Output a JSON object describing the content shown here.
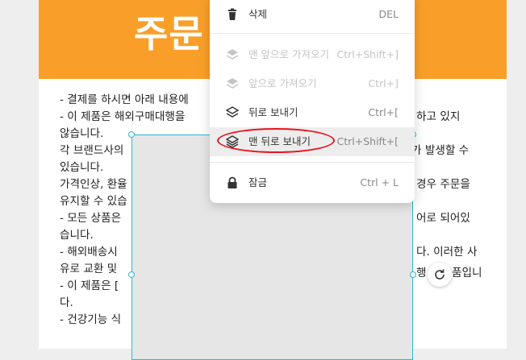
{
  "page": {
    "title": "주문",
    "lines": [
      "- 결제를 하시면 아래 내용에",
      "- 이 제품은 해외구매대행을",
      "않습니다.",
      "각 브랜드사의",
      "있습니다.",
      "가격인상, 환율",
      "유지할 수 있습",
      "- 모든 상품은",
      "습니다.",
      "- 해외배송시",
      "유로 교환 및",
      "- 이 제품은 [",
      "다.",
      "- 건강기능 식"
    ],
    "right_fragments": [
      "하고 있지",
      "가 발생할 수",
      "경우 주문을",
      "어로 되어있",
      "다. 이러한 사",
      "행",
      "품입니"
    ]
  },
  "menu": {
    "items": [
      {
        "label": "삭제",
        "shortcut": "DEL",
        "icon": "trash-icon",
        "disabled": false
      },
      {
        "label": "맨 앞으로 가져오기",
        "shortcut": "Ctrl+Shift+]",
        "icon": "layers-front-icon",
        "disabled": true
      },
      {
        "label": "앞으로 가져오기",
        "shortcut": "Ctrl+]",
        "icon": "layers-forward-icon",
        "disabled": true
      },
      {
        "label": "뒤로 보내기",
        "shortcut": "Ctrl+[",
        "icon": "layers-backward-icon",
        "disabled": false
      },
      {
        "label": "맨 뒤로 보내기",
        "shortcut": "Ctrl+Shift+[",
        "icon": "layers-back-icon",
        "disabled": false,
        "highlighted": true
      },
      {
        "label": "잠금",
        "shortcut": "Ctrl + L",
        "icon": "lock-icon",
        "disabled": false
      }
    ]
  },
  "colors": {
    "banner": "#f99f29",
    "selection": "#2ab7d8",
    "highlight_ring": "#e8141f"
  }
}
